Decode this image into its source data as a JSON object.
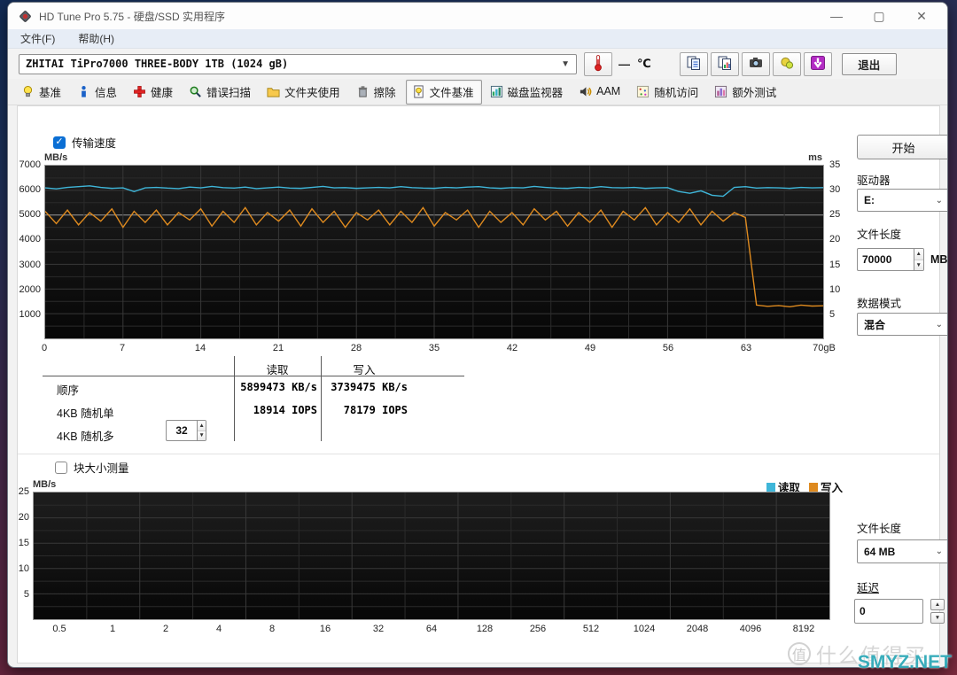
{
  "window": {
    "title": "HD Tune Pro 5.75 - 硬盘/SSD 实用程序"
  },
  "menu": {
    "items": [
      {
        "label": "文件(F)"
      },
      {
        "label": "帮助(H)"
      }
    ]
  },
  "toolbar": {
    "drive_combo": "ZHITAI TiPro7000 THREE-BODY 1TB (1024 gB)",
    "temperature": {
      "value": "—",
      "unit": "℃"
    },
    "buttons": [
      {
        "icon": "copy-report-icon"
      },
      {
        "icon": "copy-chart-icon"
      },
      {
        "icon": "screenshot-icon"
      },
      {
        "icon": "color-settings-icon"
      },
      {
        "icon": "download-icon"
      }
    ],
    "exit_label": "退出"
  },
  "tabs": [
    {
      "label": "基准",
      "icon": "bulb-icon"
    },
    {
      "label": "信息",
      "icon": "info-icon"
    },
    {
      "label": "健康",
      "icon": "health-icon"
    },
    {
      "label": "错误扫描",
      "icon": "error-scan-icon"
    },
    {
      "label": "文件夹使用",
      "icon": "folder-icon"
    },
    {
      "label": "擦除",
      "icon": "erase-icon"
    },
    {
      "label": "文件基准",
      "icon": "file-benchmark-icon",
      "active": true
    },
    {
      "label": "磁盘监视器",
      "icon": "disk-monitor-icon"
    },
    {
      "label": "AAM",
      "icon": "aam-icon"
    },
    {
      "label": "随机访问",
      "icon": "random-access-icon"
    },
    {
      "label": "额外测试",
      "icon": "extra-tests-icon"
    }
  ],
  "benchmark": {
    "transfer_checkbox": "传输速度",
    "block_checkbox": "块大小测量",
    "legend": {
      "read": "读取",
      "write": "写入"
    },
    "table": {
      "headers": {
        "read": "读取",
        "write": "写入"
      },
      "rows": [
        {
          "label": "顺序",
          "read": "5899473 KB/s",
          "write": "3739475 KB/s"
        },
        {
          "label": "4KB 随机单",
          "read": "18914 IOPS",
          "write": "78179 IOPS"
        },
        {
          "label": "4KB 随机多",
          "stepper": "32"
        }
      ]
    }
  },
  "sidebar": {
    "start_button": "开始",
    "drive_label": "驱动器",
    "drive_value": "E:",
    "file_length_label": "文件长度",
    "file_length_value": "70000",
    "file_length_unit": "MB",
    "data_mode_label": "数据模式",
    "data_mode_value": "混合",
    "file_length2_label": "文件长度",
    "file_length2_value": "64 MB",
    "delay_label": "延迟",
    "delay_value": "0"
  },
  "watermark": {
    "badge": "值",
    "text": "什么值得买",
    "site": "SMYZ.NET"
  },
  "colors": {
    "read": "#3fb6d9",
    "write": "#de8a1f",
    "accent_blue": "#0b6fd4"
  },
  "chart_data": [
    {
      "type": "line",
      "title": "传输速度",
      "ylabel": "MB/s",
      "y2label": "ms",
      "ylim": [
        0,
        7000
      ],
      "y2lim": [
        0,
        35
      ],
      "yticks": [
        7000,
        6000,
        5000,
        4000,
        3000,
        2000,
        1000
      ],
      "y2ticks": [
        35,
        30,
        25,
        20,
        15,
        10,
        5
      ],
      "xtick_labels": [
        "0",
        "7",
        "14",
        "21",
        "28",
        "35",
        "42",
        "49",
        "56",
        "63",
        "70gB"
      ],
      "x_unit": "gB",
      "grid": {
        "h_step": 500,
        "v_div": 20,
        "highlight_value": 5000
      },
      "legend_position": "none",
      "series": [
        {
          "name": "写入",
          "color": "#de8a1f",
          "values": [
            5150,
            4650,
            5200,
            4600,
            5100,
            4750,
            5250,
            4500,
            5150,
            4700,
            5200,
            4600,
            5100,
            4800,
            5250,
            4550,
            5150,
            4700,
            5300,
            4600,
            5100,
            4750,
            5200,
            4550,
            5250,
            4700,
            5150,
            4500,
            5100,
            4800,
            5200,
            4600,
            5150,
            4700,
            5300,
            4550,
            5100,
            4800,
            5200,
            4500,
            5150,
            4700,
            5100,
            4600,
            5250,
            4800,
            5150,
            4550,
            5100,
            4700,
            5200,
            4500,
            5150,
            4800,
            5300,
            4600,
            5100,
            4700,
            5250,
            4600,
            5150,
            4750,
            5100,
            4900,
            1350,
            1300,
            1330,
            1280,
            1350,
            1310,
            1320
          ]
        },
        {
          "name": "读取",
          "color": "#3fb6d9",
          "values": [
            6100,
            6060,
            6120,
            6150,
            6180,
            6120,
            6080,
            6100,
            5950,
            6100,
            6120,
            6090,
            6070,
            6130,
            6100,
            6160,
            6110,
            6090,
            6130,
            6070,
            6100,
            6130,
            6090,
            6080,
            6120,
            6160,
            6100,
            6110,
            6080,
            6100,
            6120,
            6100,
            6150,
            6110,
            6090,
            6080,
            6120,
            6100,
            6130,
            6150,
            6100,
            6080,
            6110,
            6100,
            6160,
            6120,
            6090,
            6080,
            6120,
            6100,
            6150,
            6110,
            6100,
            6120,
            6080,
            6100,
            6110,
            5950,
            5880,
            5980,
            5800,
            5760,
            6120,
            6150,
            6090,
            6110,
            6100,
            6080,
            6120,
            6100,
            6110
          ]
        }
      ]
    },
    {
      "type": "line",
      "title": "块大小测量",
      "ylabel": "MB/s",
      "ylim": [
        0,
        25
      ],
      "yticks": [
        25,
        20,
        15,
        10,
        5
      ],
      "xtick_labels": [
        "0.5",
        "1",
        "2",
        "4",
        "8",
        "16",
        "32",
        "64",
        "128",
        "256",
        "512",
        "1024",
        "2048",
        "4096",
        "8192"
      ],
      "x_label_align": "center",
      "grid": {
        "h_step": 2.5,
        "v_div": 15
      },
      "legend_position": "top-right",
      "series": [
        {
          "name": "读取",
          "color": "#3fb6d9",
          "values": []
        },
        {
          "name": "写入",
          "color": "#de8a1f",
          "values": []
        }
      ]
    }
  ]
}
